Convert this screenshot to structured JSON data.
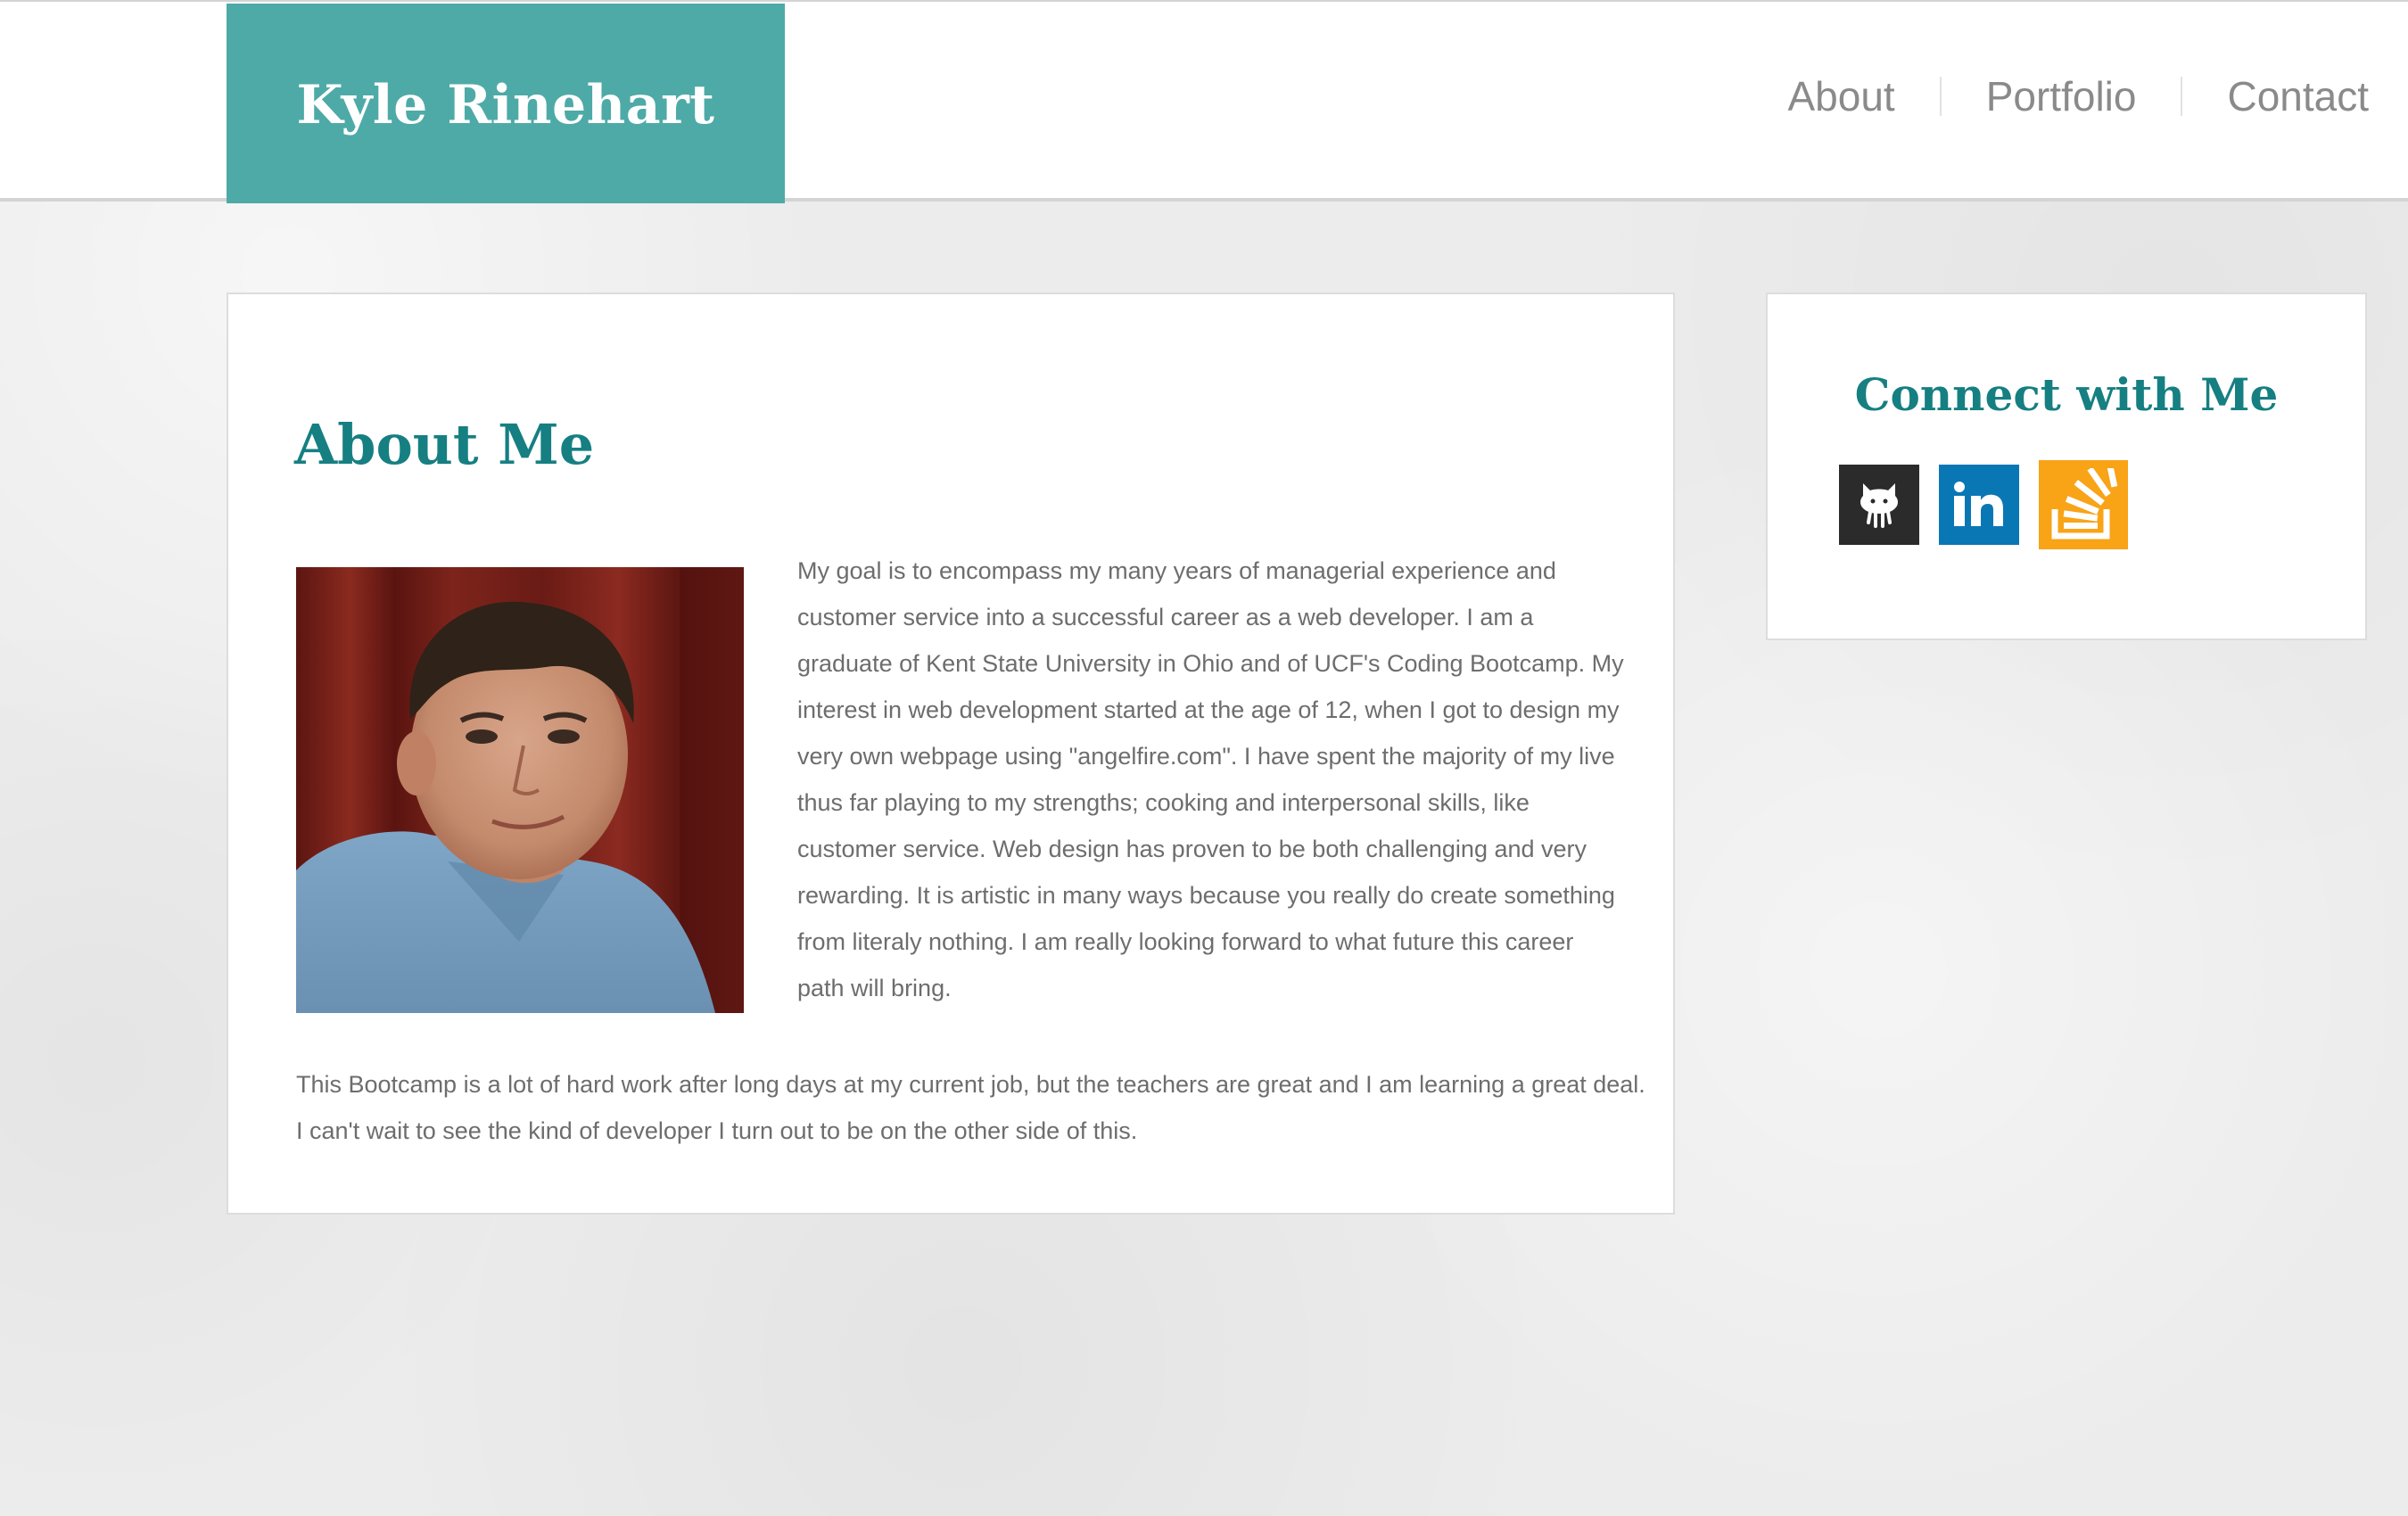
{
  "header": {
    "brand": "Kyle Rinehart",
    "brand_color": "#4eaaa7",
    "nav": [
      {
        "label": "About"
      },
      {
        "label": "Portfolio"
      },
      {
        "label": "Contact"
      }
    ]
  },
  "about": {
    "title": "About Me",
    "photo_icon": "profile-photo",
    "paragraph_1": "My goal is to encompass my many years of managerial experience and customer service into a successful career as a web developer. I am a graduate of Kent State University in Ohio and of UCF's Coding Bootcamp. My interest in web development started at the age of 12, when I got to design my very own webpage using \"angelfire.com\". I have spent the majority of my live thus far playing to my strengths; cooking and interpersonal skills, like customer service. Web design has proven to be both challenging and very rewarding. It is artistic in many ways because you really do create something from literaly nothing. I am really looking forward to what future this career path will bring.",
    "paragraph_2": "This Bootcamp is a lot of hard work after long days at my current job, but the teachers are great and I am learning a great deal. I can't wait to see the kind of developer I turn out to be on the other side of this."
  },
  "connect": {
    "title": "Connect with Me",
    "title_color": "#167f82",
    "social": [
      {
        "icon": "github-icon",
        "color": "#2b2b2b"
      },
      {
        "icon": "linkedin-icon",
        "color": "#0a77b5"
      },
      {
        "icon": "stackoverflow-icon",
        "color": "#f9a317"
      }
    ]
  }
}
